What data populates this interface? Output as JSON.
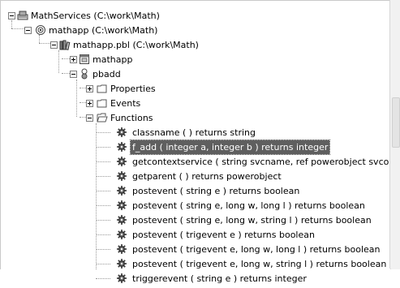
{
  "tree": {
    "root": {
      "label": "MathServices (C:\\work\\Math)",
      "icon": "workspace-icon"
    },
    "target": {
      "label": "mathapp (C:\\work\\Math)",
      "icon": "target-icon"
    },
    "library": {
      "label": "mathapp.pbl (C:\\work\\Math)",
      "icon": "library-icon"
    },
    "app_object": {
      "label": "mathapp",
      "icon": "application-icon"
    },
    "nvo": {
      "label": "pbadd",
      "icon": "nonvisual-object-icon"
    },
    "properties": {
      "label": "Properties",
      "icon": "folder-closed-icon"
    },
    "events": {
      "label": "Events",
      "icon": "folder-closed-icon"
    },
    "functions": {
      "label": "Functions",
      "icon": "folder-open-icon"
    },
    "function_items": [
      {
        "label": "classname ( ) returns string",
        "selected": false
      },
      {
        "label": "f_add ( integer a, integer b ) returns integer",
        "selected": true
      },
      {
        "label": "getcontextservice ( string svcname, ref powerobject svcobj )",
        "selected": false
      },
      {
        "label": "getparent ( ) returns powerobject",
        "selected": false
      },
      {
        "label": "postevent ( string e ) returns boolean",
        "selected": false
      },
      {
        "label": "postevent ( string e, long w, long l ) returns boolean",
        "selected": false
      },
      {
        "label": "postevent ( string e, long w, string l ) returns boolean",
        "selected": false
      },
      {
        "label": "postevent ( trigevent e ) returns boolean",
        "selected": false
      },
      {
        "label": "postevent ( trigevent e, long w, long l ) returns boolean",
        "selected": false
      },
      {
        "label": "postevent ( trigevent e, long w, string l ) returns boolean",
        "selected": false
      },
      {
        "label": "triggerevent ( string e ) returns integer",
        "selected": false
      }
    ]
  }
}
